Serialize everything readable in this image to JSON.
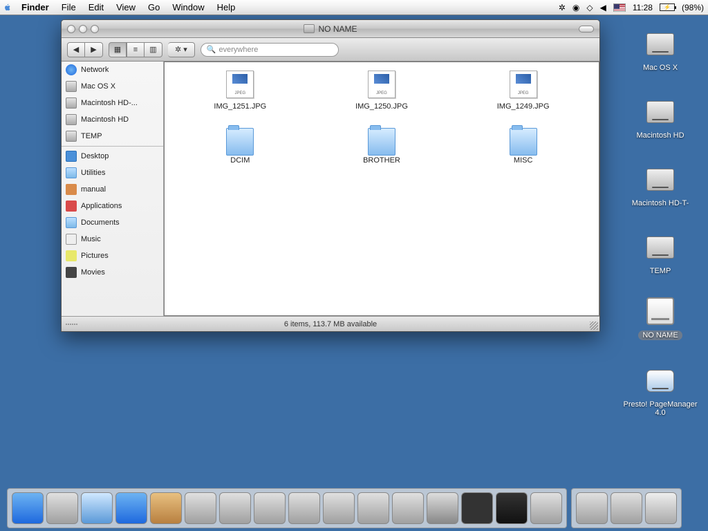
{
  "menubar": {
    "app": "Finder",
    "items": [
      "File",
      "Edit",
      "View",
      "Go",
      "Window",
      "Help"
    ],
    "clock": "11:28",
    "battery": "(98%)"
  },
  "desktop": {
    "icons": [
      {
        "label": "Mac OS X",
        "type": "disk"
      },
      {
        "label": "Macintosh HD",
        "type": "disk"
      },
      {
        "label": "Macintosh HD-T-",
        "type": "disk"
      },
      {
        "label": "TEMP",
        "type": "disk"
      },
      {
        "label": "NO NAME",
        "type": "ext",
        "selected": true
      },
      {
        "label": "Presto! PageManager 4.0",
        "type": "app"
      }
    ]
  },
  "window": {
    "title": "NO NAME",
    "search_placeholder": "everywhere",
    "sidebar": {
      "volumes": [
        {
          "label": "Network",
          "ic": "ic-net"
        },
        {
          "label": "Mac OS X",
          "ic": "ic-hd"
        },
        {
          "label": "Macintosh HD-...",
          "ic": "ic-hd"
        },
        {
          "label": "Macintosh HD",
          "ic": "ic-hd"
        },
        {
          "label": "TEMP",
          "ic": "ic-hd"
        }
      ],
      "places": [
        {
          "label": "Desktop",
          "ic": "ic-desk"
        },
        {
          "label": "Utilities",
          "ic": "ic-fold"
        },
        {
          "label": "manual",
          "ic": "ic-home"
        },
        {
          "label": "Applications",
          "ic": "ic-app"
        },
        {
          "label": "Documents",
          "ic": "ic-fold"
        },
        {
          "label": "Music",
          "ic": "ic-music"
        },
        {
          "label": "Pictures",
          "ic": "ic-pic"
        },
        {
          "label": "Movies",
          "ic": "ic-mov"
        }
      ]
    },
    "files": [
      {
        "name": "IMG_1251.JPG",
        "type": "jpeg"
      },
      {
        "name": "IMG_1250.JPG",
        "type": "jpeg"
      },
      {
        "name": "IMG_1249.JPG",
        "type": "jpeg"
      },
      {
        "name": "DCIM",
        "type": "folder"
      },
      {
        "name": "BROTHER",
        "type": "folder"
      },
      {
        "name": "MISC",
        "type": "folder"
      }
    ],
    "status": "6 items, 113.7 MB available"
  },
  "dock": {
    "items": [
      "finder",
      "ichat",
      "safari",
      "ie",
      "addressbook",
      "iphoto",
      "imagecapture",
      "textedit",
      "stickies",
      "capture",
      "quicktime",
      "printer",
      "sysprefs",
      "dashboard",
      "activity",
      "pagemanager"
    ],
    "right": [
      "applications",
      "disk",
      "trash"
    ]
  }
}
